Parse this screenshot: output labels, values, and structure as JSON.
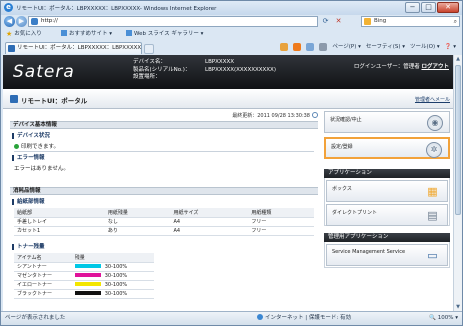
{
  "window": {
    "title": "リモートUI：ポータル：LBPXXXXX：LBPXXXXX- Windows Internet Explorer",
    "controls": [
      "−",
      "□",
      "✕"
    ]
  },
  "address_bar": {
    "url": "http://",
    "search_value": "Bing",
    "search_icon": "magnifier-icon"
  },
  "favorites_bar": {
    "favorites_label": "お気に入り",
    "items": [
      "おすすめサイト ▾",
      "Web スライス ギャラリー ▾"
    ]
  },
  "tab": {
    "label": "リモートUI：ポータル：LBPXXXXX：LBPXXXXX"
  },
  "command_bar": {
    "items": [
      "ページ(P) ▾",
      "セーフティ(S) ▾",
      "ツール(O) ▾",
      "❓ ▾"
    ]
  },
  "header": {
    "logo": "Satera",
    "device_rows": [
      {
        "key": "デバイス名：",
        "value": "LBPXXXXX"
      },
      {
        "key": "製品名(シリアルNo.)：",
        "value": "LBPXXXXX(XXXXXXXXXX)"
      },
      {
        "key": "設置場所：",
        "value": ""
      }
    ],
    "login_text": "ログインユーザー：管理者",
    "logout_label": "ログアウト"
  },
  "portal": {
    "title": "リモートUI：ポータル",
    "mail_link": "管理者へメール"
  },
  "status_area": {
    "last_updated": "最終更新：2011 09/28 13:30:38",
    "basic_info_title": "デバイス基本情報",
    "device_state_title": "デバイス状況",
    "device_state_text": "印刷できます。",
    "error_title": "エラー情報",
    "error_text": "エラーはありません。"
  },
  "consumables": {
    "section_title": "消耗品情報",
    "paper_title": "給紙部情報",
    "paper_headers": [
      "給紙部",
      "用紙残量",
      "用紙サイズ",
      "用紙種類"
    ],
    "paper_rows": [
      [
        "手差しトレイ",
        "なし",
        "A4",
        "フリー"
      ],
      [
        "カセット1",
        "あり",
        "A4",
        "フリー"
      ]
    ],
    "toner_title": "トナー残量",
    "toner_headers": [
      "アイテム名",
      "残量"
    ],
    "toner_rows": [
      {
        "name": "シアントナー",
        "level": "30-100%",
        "color": "#00c8e6"
      },
      {
        "name": "マゼンタトナー",
        "level": "30-100%",
        "color": "#e0139a"
      },
      {
        "name": "イエロートナー",
        "level": "30-100%",
        "color": "#f3e600"
      },
      {
        "name": "ブラックトナー",
        "level": "30-100%",
        "color": "#111111"
      }
    ]
  },
  "side": {
    "status_monitor": "状況確認/中止",
    "settings": "設定/登録",
    "apps_title": "アプリケーション",
    "box": "ボックス",
    "direct_print": "ダイレクトプリント",
    "mgmt_title": "管理用アプリケーション",
    "service_mgmt": "Service Management Service"
  },
  "statusbar": {
    "left": "ページが表示されました",
    "zone": "インターネット | 保護モード: 有効",
    "zoom": "🔍 100% ▾"
  },
  "colors": {
    "header_bg": "#1b1e22",
    "selected_border": "#f2a23a",
    "link": "#1d3e6b"
  }
}
